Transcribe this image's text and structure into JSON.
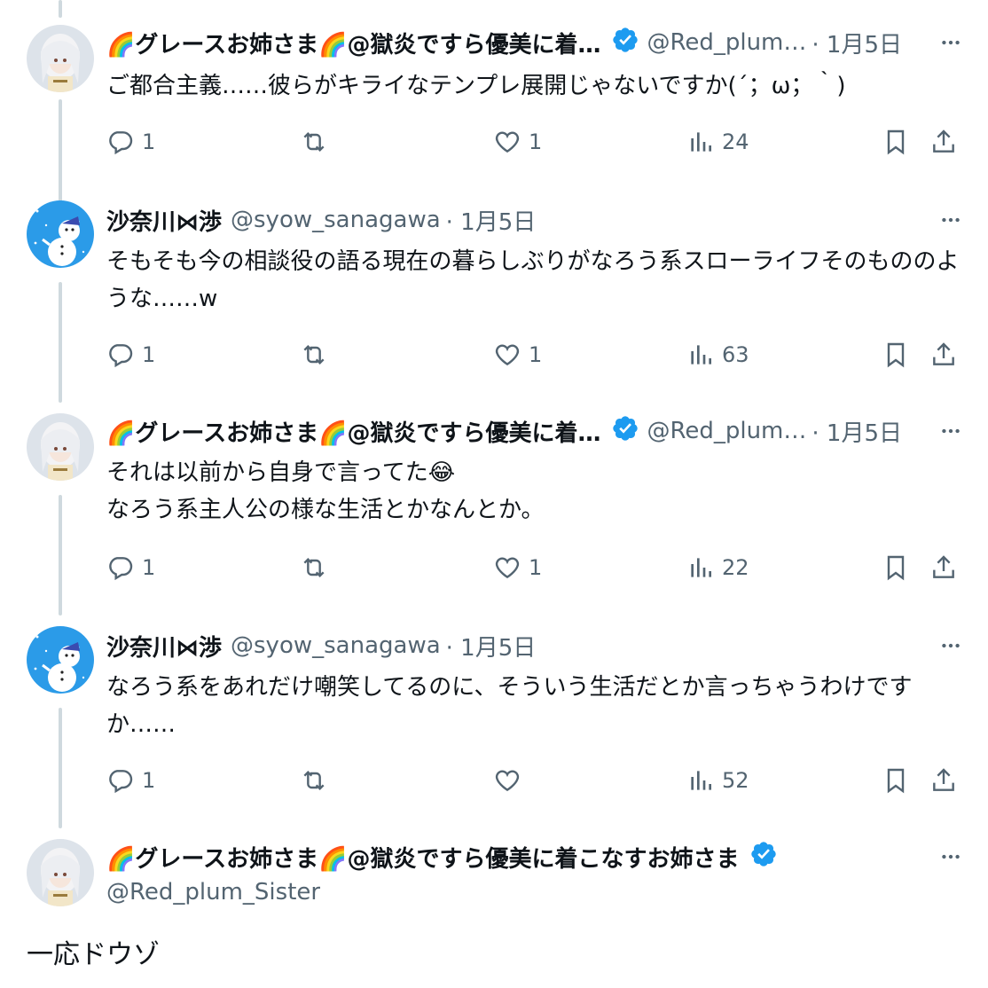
{
  "tweets": [
    {
      "display_name": "🌈グレースお姉さま🌈@獄炎ですら優美に着…",
      "handle": "@Red_plum…",
      "date": "· 1月5日",
      "text": "ご都合主義……彼らがキライなテンプレ展開じゃないですか(´；ω；｀)",
      "replies": "1",
      "retweets": "",
      "likes": "1",
      "views": "24",
      "verified": true,
      "avatar": "woman-avatar"
    },
    {
      "display_name": "沙奈川⋈渉",
      "handle": "@syow_sanagawa",
      "date": "· 1月5日",
      "text": "そもそも今の相談役の語る現在の暮らしぶりがなろう系スローライフそのもののよ\nうな……w",
      "replies": "1",
      "retweets": "",
      "likes": "1",
      "views": "63",
      "verified": false,
      "avatar": "snowman-avatar"
    },
    {
      "display_name": "🌈グレースお姉さま🌈@獄炎ですら優美に着…",
      "handle": "@Red_plum…",
      "date": "· 1月5日",
      "text": "それは以前から自身で言ってた😂\nなろう系主人公の様な生活とかなんとか。",
      "replies": "1",
      "retweets": "",
      "likes": "1",
      "views": "22",
      "verified": true,
      "avatar": "woman-avatar"
    },
    {
      "display_name": "沙奈川⋈渉",
      "handle": "@syow_sanagawa",
      "date": "· 1月5日",
      "text": "なろう系をあれだけ嘲笑してるのに、そういう生活だとか言っちゃうわけです\nか……",
      "replies": "1",
      "retweets": "",
      "likes": "",
      "views": "52",
      "verified": false,
      "avatar": "snowman-avatar"
    }
  ],
  "main_tweet": {
    "display_name": "🌈グレースお姉さま🌈@獄炎ですら優美に着こなすお姉さま",
    "handle": "@Red_plum_Sister",
    "text": "一応ドウゾ"
  },
  "colors": {
    "verified": "#1d9bf0",
    "secondary_text": "#536471",
    "thread_line": "#cfd9de"
  }
}
